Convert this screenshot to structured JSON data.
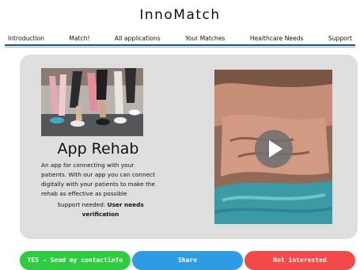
{
  "brand": "InnoMatch",
  "nav": {
    "items": [
      "Introduction",
      "Match!",
      "All applications",
      "Your Matches",
      "Healthcare Needs",
      "Support"
    ]
  },
  "app": {
    "title": "App Rehab",
    "description": "An app for connecting with your patients. With our app you can connect digitally with your patients to make the rehab as effective as possible",
    "support_label": "Support needed: ",
    "support_value": "User needs verification"
  },
  "video": {
    "play_icon": "play-icon"
  },
  "actions": {
    "yes": "YES - Send my contactinfo",
    "share": "Share",
    "no": "Not interested"
  },
  "colors": {
    "accent_line": "#1d4f86",
    "yes": "#2ecc40",
    "share": "#2e9be5",
    "no": "#f24949",
    "card": "#dedede"
  }
}
